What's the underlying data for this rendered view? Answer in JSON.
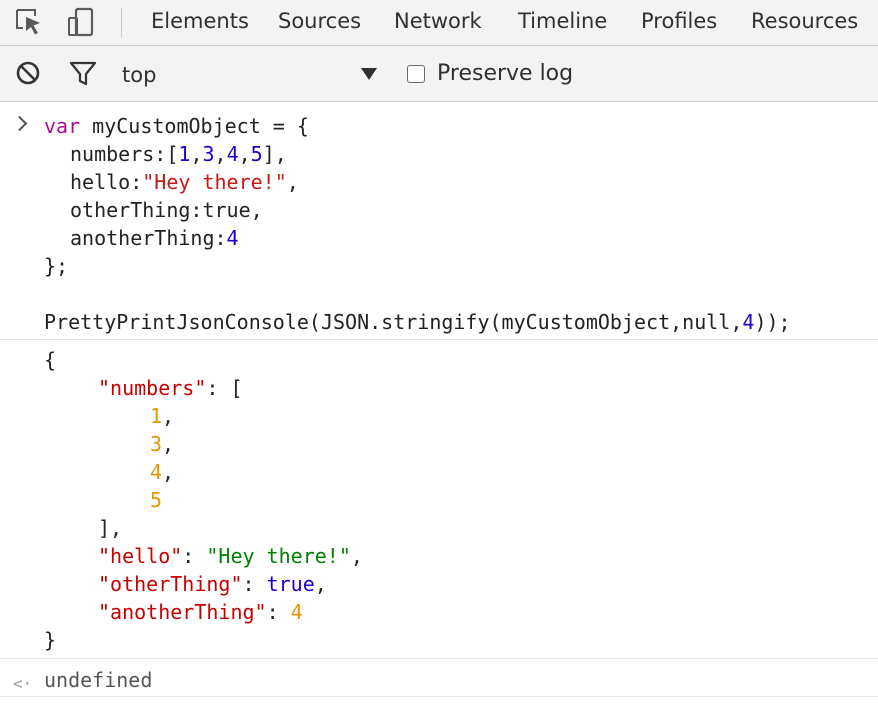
{
  "devtools": {
    "tabs": [
      {
        "label": "Elements"
      },
      {
        "label": "Sources"
      },
      {
        "label": "Network"
      },
      {
        "label": "Timeline"
      },
      {
        "label": "Profiles"
      },
      {
        "label": "Resources"
      }
    ],
    "toolbar": {
      "context": "top",
      "preserve_log_label": "Preserve log",
      "preserve_log_checked": false
    }
  },
  "console": {
    "input": {
      "l1": {
        "kw": "var",
        "rest": " myCustomObject = {"
      },
      "l2": {
        "prop": "numbers",
        "open": "[",
        "n1": "1",
        "n2": "3",
        "n3": "4",
        "n4": "5",
        "close": "],"
      },
      "l3": {
        "prop": "hello",
        "str": "\"Hey there!\"",
        "end": ","
      },
      "l4": {
        "prop": "otherThing",
        "val": "true",
        "end": ","
      },
      "l5": {
        "prop": "anotherThing",
        "num": "4"
      },
      "l6": "};",
      "l7": {
        "pre": "PrettyPrintJsonConsole(JSON.stringify(myCustomObject,null,",
        "num": "4",
        "post": "));"
      }
    },
    "output": {
      "open_brace": "{",
      "numbers_key": "\"numbers\"",
      "numbers_open": ": [",
      "numbers": [
        "1",
        "3",
        "4",
        "5"
      ],
      "numbers_close": "],",
      "hello_key": "\"hello\"",
      "hello_value": "\"Hey there!\"",
      "other_key": "\"otherThing\"",
      "other_value": "true",
      "another_key": "\"anotherThing\"",
      "another_value": "4",
      "close_brace": "}"
    },
    "result": "undefined"
  }
}
